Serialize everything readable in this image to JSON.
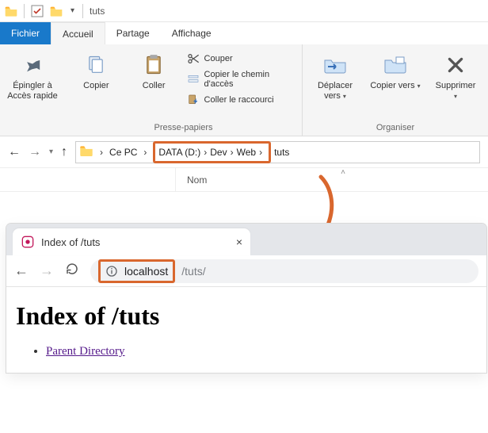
{
  "titlebar": {
    "title": "tuts"
  },
  "tabs": {
    "file": "Fichier",
    "home": "Accueil",
    "share": "Partage",
    "view": "Affichage"
  },
  "ribbon": {
    "pin": {
      "label": "Épingler à Accès rapide"
    },
    "copy": {
      "label": "Copier"
    },
    "paste": {
      "label": "Coller"
    },
    "cut": {
      "label": "Couper"
    },
    "copypath": {
      "label": "Copier le chemin d'accès"
    },
    "pasteshortcut": {
      "label": "Coller le raccourci"
    },
    "clipboard_group": "Presse-papiers",
    "moveto": {
      "label": "Déplacer vers"
    },
    "copyto": {
      "label": "Copier vers"
    },
    "delete": {
      "label": "Supprimer"
    },
    "organize_group": "Organiser"
  },
  "breadcrumb": {
    "pc": "Ce PC",
    "drive": "DATA (D:)",
    "dev": "Dev",
    "web": "Web",
    "tuts": "tuts"
  },
  "columns": {
    "name": "Nom"
  },
  "browser": {
    "tab_title": "Index of /tuts",
    "addr_host": "localhost",
    "addr_path": "/tuts/",
    "page_heading": "Index of /tuts",
    "parent_link": "Parent Directory"
  }
}
